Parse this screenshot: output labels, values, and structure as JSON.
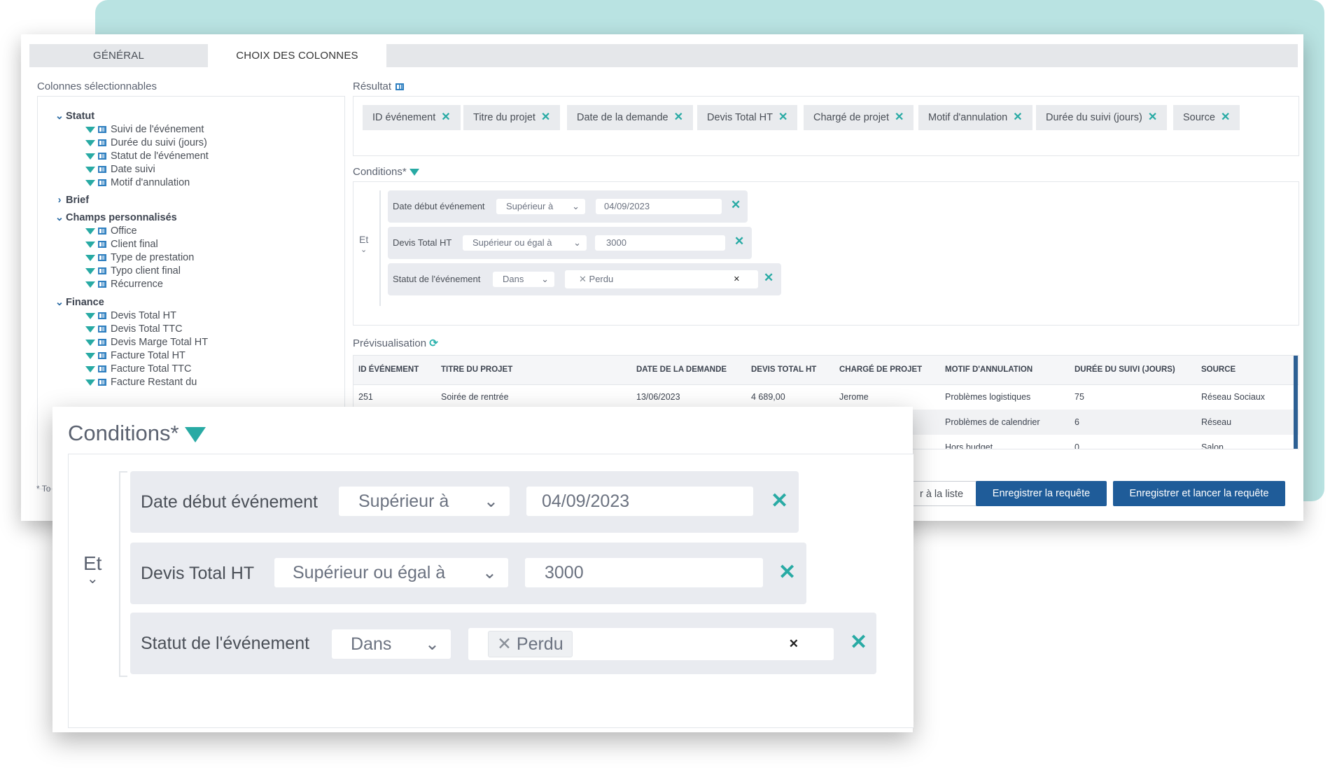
{
  "tabs": [
    "GÉNÉRAL",
    "CHOIX DES COLONNES"
  ],
  "left": {
    "label": "Colonnes sélectionnables",
    "groups": [
      {
        "name": "Statut",
        "expanded": true,
        "items": [
          "Suivi de l'événement",
          "Durée du suivi (jours)",
          "Statut de l'événement",
          "Date suivi",
          "Motif d'annulation"
        ]
      },
      {
        "name": "Brief",
        "expanded": false,
        "items": []
      },
      {
        "name": "Champs personnalisés",
        "expanded": true,
        "items": [
          "Office",
          "Client final",
          "Type de prestation",
          "Typo client final",
          "Récurrence"
        ]
      },
      {
        "name": "Finance",
        "expanded": true,
        "items": [
          "Devis Total HT",
          "Devis Total TTC",
          "Devis Marge Total HT",
          "Facture Total HT",
          "Facture Total TTC",
          "Facture Restant du"
        ]
      }
    ],
    "footnote": "* To"
  },
  "result": {
    "label": "Résultat",
    "chips": [
      "ID événement",
      "Titre du projet",
      "Date de la demande",
      "Devis Total HT",
      "Chargé de projet",
      "Motif d'annulation",
      "Durée du suivi (jours)",
      "Source"
    ]
  },
  "conditions": {
    "label": "Conditions*",
    "operator": "Et",
    "rows": [
      {
        "field": "Date début événement",
        "op": "Supérieur à",
        "value": "04/09/2023"
      },
      {
        "field": "Devis Total HT",
        "op": "Supérieur ou égal à",
        "value": "3000"
      },
      {
        "field": "Statut de l'événement",
        "op": "Dans",
        "tag": "Perdu"
      }
    ]
  },
  "preview": {
    "label": "Prévisualisation",
    "headers": [
      "ID ÉVÉNEMENT",
      "TITRE DU PROJET",
      "DATE DE LA DEMANDE",
      "DEVIS TOTAL HT",
      "CHARGÉ DE PROJET",
      "MOTIF D'ANNULATION",
      "DURÉE DU SUIVI (JOURS)",
      "SOURCE"
    ],
    "rows": [
      [
        "251",
        "Soirée de rentrée",
        "13/06/2023",
        "4 689,00",
        "Jerome",
        "Problèmes logistiques",
        "75",
        "Réseau Sociaux"
      ],
      [
        "",
        "",
        "",
        "",
        "",
        "Problèmes de calendrier",
        "6",
        "Réseau"
      ],
      [
        "",
        "",
        "",
        "",
        "",
        "Hors budget",
        "0",
        "Salon"
      ]
    ]
  },
  "buttons": {
    "back": "r à la liste",
    "save": "Enregistrer la requête",
    "save_run": "Enregistrer et lancer la requête"
  },
  "colors": {
    "teal": "#2bb3ae",
    "primary": "#1f5c99",
    "accent_bg": "#b9e3e2"
  }
}
